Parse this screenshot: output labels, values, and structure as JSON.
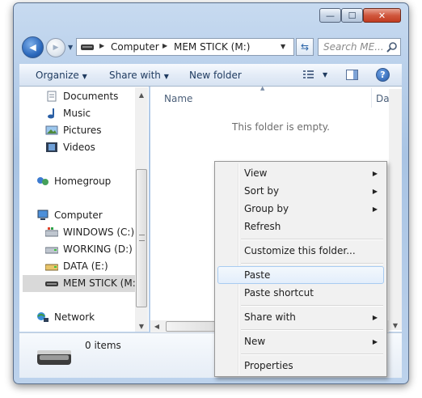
{
  "window": {
    "caption_buttons": {
      "minimize": "—",
      "maximize": "☐",
      "close": "✕"
    }
  },
  "nav": {
    "back_glyph": "◀",
    "forward_glyph": "▶",
    "address": {
      "segments": [
        "Computer",
        "MEM STICK (M:)"
      ],
      "separator": "▶"
    },
    "search_placeholder": "Search ME..."
  },
  "toolbar": {
    "organize": "Organize",
    "share_with": "Share with",
    "new_folder": "New folder"
  },
  "sidebar": {
    "libraries": [
      {
        "label": "Documents",
        "icon": "documents-icon"
      },
      {
        "label": "Music",
        "icon": "music-icon"
      },
      {
        "label": "Pictures",
        "icon": "pictures-icon"
      },
      {
        "label": "Videos",
        "icon": "videos-icon"
      }
    ],
    "homegroup": "Homegroup",
    "computer": "Computer",
    "drives": [
      {
        "label": "WINDOWS (C:)",
        "icon": "windows-drive-icon"
      },
      {
        "label": "WORKING (D:)",
        "icon": "drive-icon"
      },
      {
        "label": "DATA (E:)",
        "icon": "drive-icon"
      },
      {
        "label": "MEM STICK (M:)",
        "icon": "usb-drive-icon",
        "selected": true
      }
    ],
    "network": "Network"
  },
  "content": {
    "columns": [
      "Name",
      "Date m"
    ],
    "empty_message": "This folder is empty."
  },
  "details": {
    "item_count": "0 items"
  },
  "context_menu": {
    "groups": [
      [
        {
          "label": "View",
          "submenu": true
        },
        {
          "label": "Sort by",
          "submenu": true
        },
        {
          "label": "Group by",
          "submenu": true
        },
        {
          "label": "Refresh",
          "submenu": false
        }
      ],
      [
        {
          "label": "Customize this folder...",
          "submenu": false
        }
      ],
      [
        {
          "label": "Paste",
          "submenu": false,
          "highlighted": true
        },
        {
          "label": "Paste shortcut",
          "submenu": false
        }
      ],
      [
        {
          "label": "Share with",
          "submenu": true
        }
      ],
      [
        {
          "label": "New",
          "submenu": true
        }
      ],
      [
        {
          "label": "Properties",
          "submenu": false
        }
      ]
    ]
  },
  "colors": {
    "selection": "#d9d9d9",
    "menu_highlight_border": "#a8cbf1",
    "frame": "#a9c4e4"
  }
}
